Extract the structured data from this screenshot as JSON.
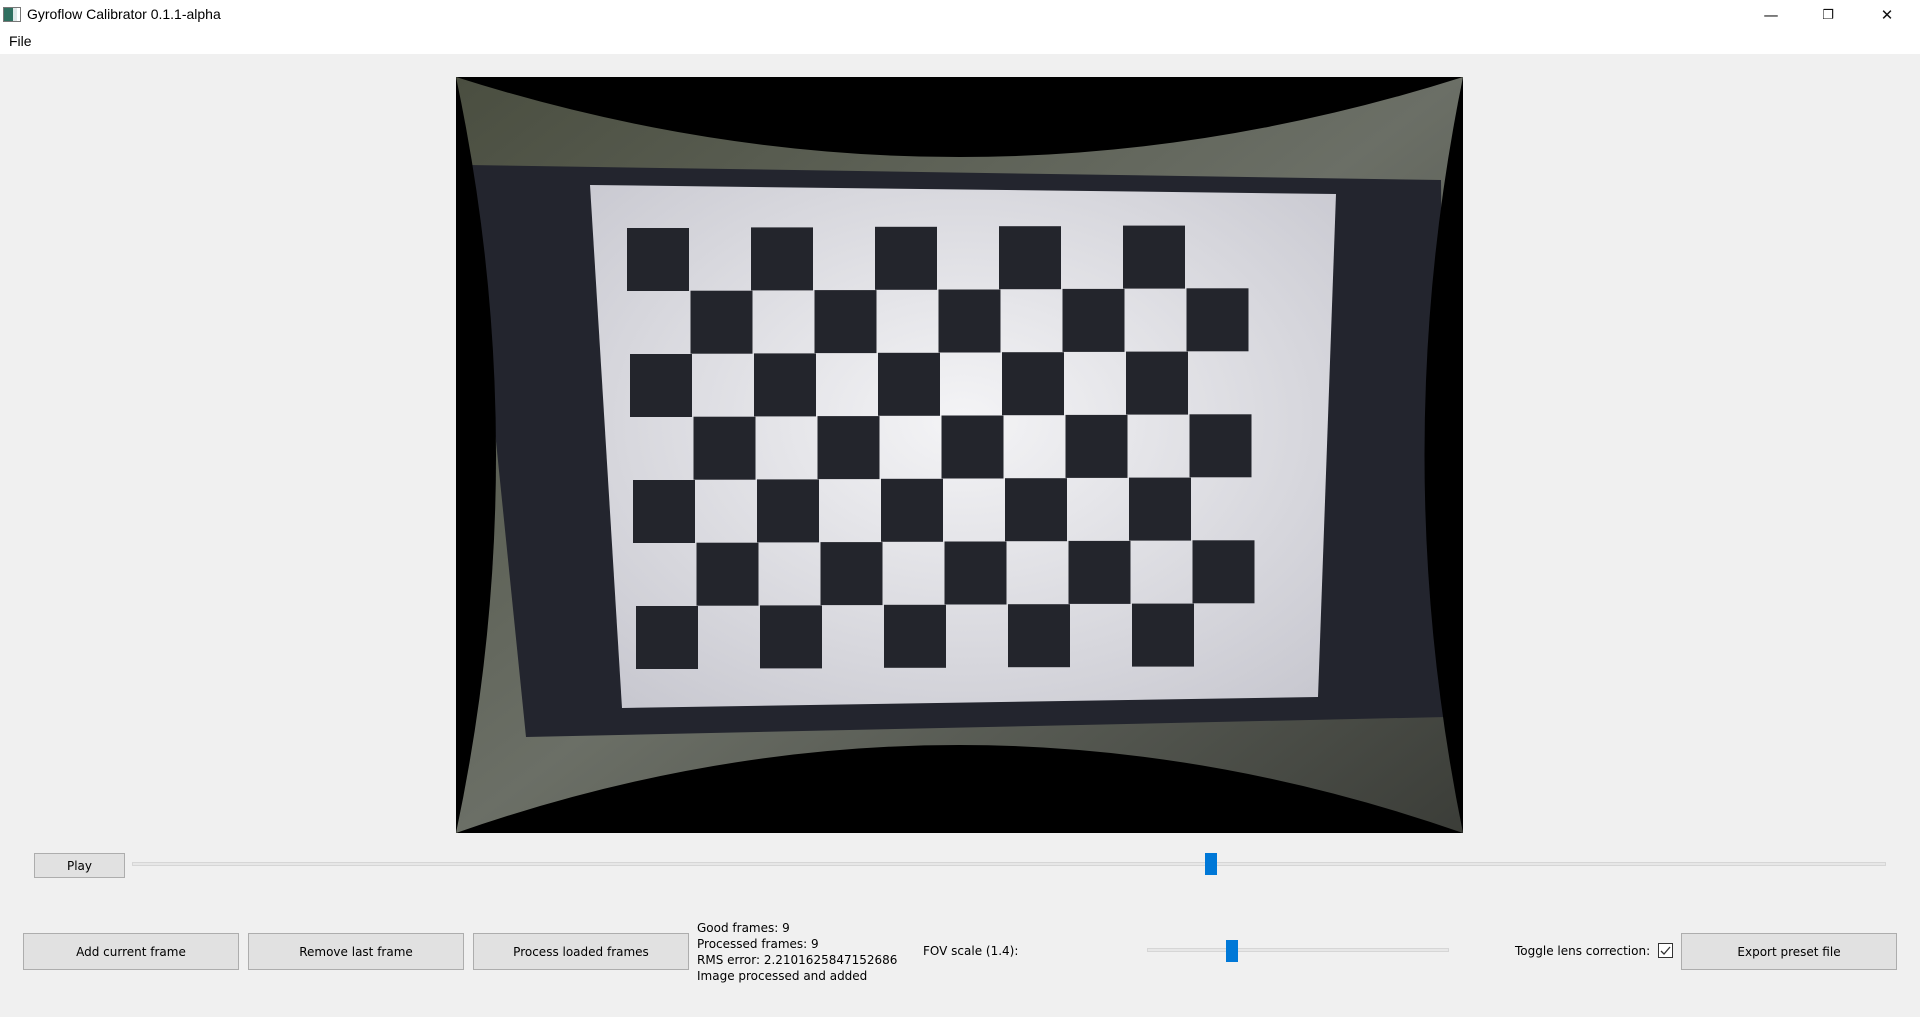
{
  "window": {
    "title": "Gyroflow Calibrator 0.1.1-alpha",
    "controls": {
      "minimize": "—",
      "restore": "❐",
      "close": "✕"
    }
  },
  "menu": {
    "items": [
      {
        "label": "File"
      }
    ]
  },
  "playback": {
    "play_label": "Play",
    "position_fraction": 0.615
  },
  "actions": {
    "add_frame_label": "Add current frame",
    "remove_frame_label": "Remove last frame",
    "process_frames_label": "Process loaded frames",
    "export_label": "Export preset file"
  },
  "status": {
    "good_frames": "Good frames: 9",
    "processed_frames": "Processed frames: 9",
    "rms_error": "RMS error: 2.2101625847152686",
    "message": "Image processed and added"
  },
  "fov": {
    "label": "FOV scale (1.4):",
    "value": 1.4
  },
  "lens_correction": {
    "label": "Toggle lens correction:",
    "checked": true
  },
  "colors": {
    "accent": "#0078d7",
    "background": "#f0f0f0",
    "button": "#e1e1e1"
  }
}
